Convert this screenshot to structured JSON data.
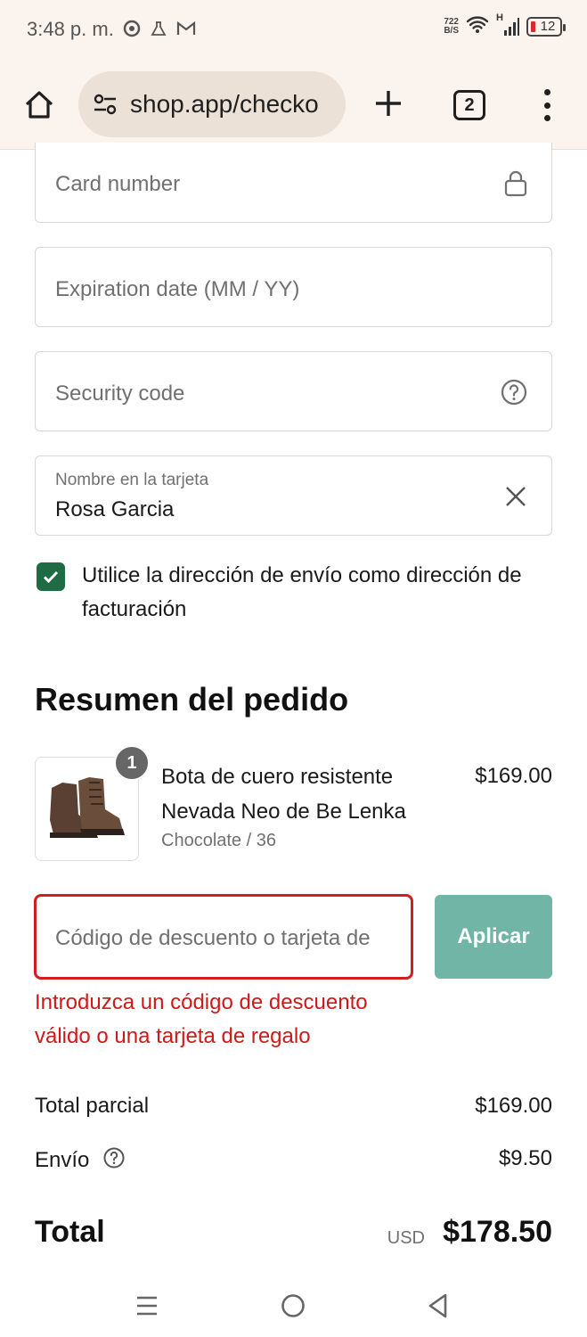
{
  "status_bar": {
    "time": "3:48 p. m.",
    "net_speed_value": "722",
    "net_speed_unit": "B/S",
    "signal_label": "H",
    "battery_level": "12"
  },
  "browser": {
    "url": "shop.app/checko",
    "tab_count": "2"
  },
  "payment_form": {
    "card_number_placeholder": "Card number",
    "expiration_placeholder": "Expiration date (MM / YY)",
    "security_code_placeholder": "Security code",
    "name_label": "Nombre en la tarjeta",
    "name_value": "Rosa Garcia",
    "use_shipping_address_label": "Utilice la dirección de envío como dirección de facturación",
    "use_shipping_address_checked": true
  },
  "order_summary": {
    "title": "Resumen del pedido",
    "items": [
      {
        "quantity": "1",
        "name": "Bota de cuero resistente Nevada Neo de Be Lenka",
        "variant": "Chocolate / 36",
        "price": "$169.00"
      }
    ],
    "discount": {
      "placeholder": "Código de descuento o tarjeta de",
      "apply_label": "Aplicar",
      "error": "Introduzca un código de descuento válido o una tarjeta de regalo"
    },
    "subtotal_label": "Total parcial",
    "subtotal_value": "$169.00",
    "shipping_label": "Envío",
    "shipping_value": "$9.50",
    "total_label": "Total",
    "total_currency": "USD",
    "total_value": "$178.50"
  },
  "colors": {
    "accent_green": "#1f6b44",
    "apply_button": "#70b5a6",
    "error_red": "#cc1a1a"
  }
}
